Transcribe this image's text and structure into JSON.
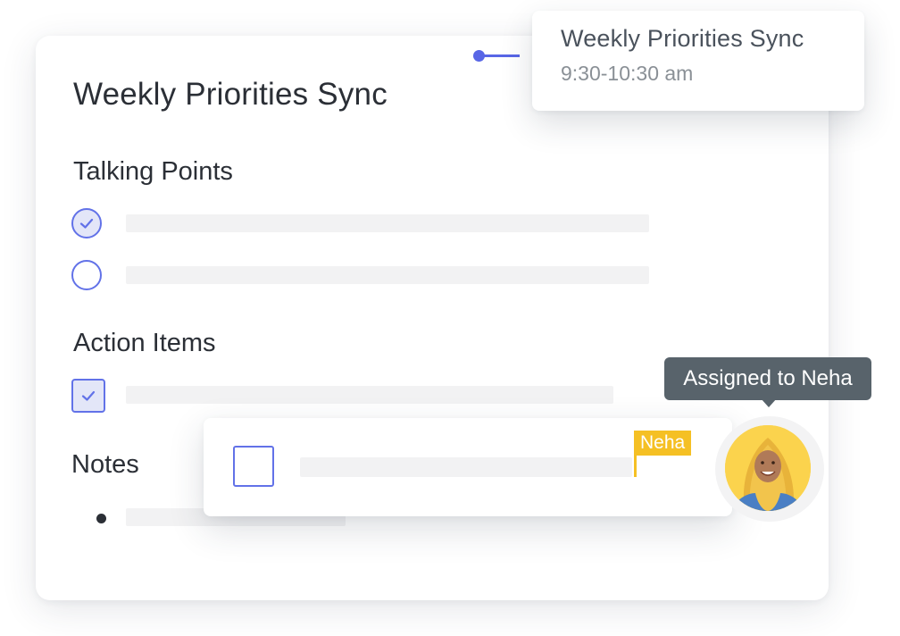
{
  "note": {
    "title": "Weekly Priorities Sync",
    "sections": {
      "talking_points": {
        "heading": "Talking Points",
        "items": [
          {
            "checked": true
          },
          {
            "checked": false
          }
        ]
      },
      "action_items": {
        "heading": "Action Items",
        "items": [
          {
            "checked": true
          }
        ]
      },
      "notes": {
        "heading": "Notes"
      }
    }
  },
  "event": {
    "title": "Weekly Priorities Sync",
    "time": "9:30-10:30 am"
  },
  "assignment": {
    "tooltip": "Assigned to Neha",
    "cursor_name": "Neha",
    "task_checked": false
  },
  "colors": {
    "accent": "#6272e8",
    "connector": "#5866e6",
    "check_fill": "#e3e6f8",
    "cursor": "#f5c024",
    "tooltip_bg": "#58636b",
    "avatar_bg": "#fbd34d"
  },
  "icons": {
    "checked_circle": "check-circle-icon",
    "empty_circle": "empty-circle-icon",
    "checked_square": "checked-checkbox-icon",
    "empty_square": "empty-checkbox-icon",
    "bullet": "bullet-icon"
  }
}
